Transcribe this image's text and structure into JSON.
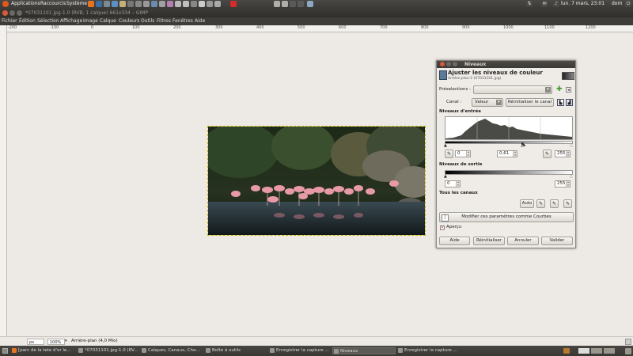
{
  "top_panel": {
    "menus": [
      "Applications",
      "Raccourcis",
      "Système"
    ],
    "clock": "lun. 7 mars, 23:01",
    "user": "dom"
  },
  "window": {
    "title": "*07031101.jpg-1.0 (RVB, 1 calque) 661x334 – GIMP"
  },
  "menu_bar": [
    "Fichier",
    "Édition",
    "Sélection",
    "Affichage",
    "Image",
    "Calque",
    "Couleurs",
    "Outils",
    "Filtres",
    "Fenêtres",
    "Aide"
  ],
  "ruler": {
    "labels": [
      "-200",
      "-100",
      "0",
      "100",
      "200",
      "300",
      "400",
      "500",
      "600",
      "700",
      "800",
      "900",
      "1000",
      "1100",
      "1200"
    ]
  },
  "status_bar": {
    "unit": "px",
    "zoom": "100%",
    "layer_info": "Arrière-plan (4,0 Mio)"
  },
  "taskbar": {
    "tasks": [
      "[parc de la tete d'or le...",
      "*07031101.jpg-1.0 (RV...",
      "Calques, Canaux, Che...",
      "Boîte à outils",
      "Enregistrer la capture ...",
      "Niveaux",
      "Enregistrer la capture ..."
    ]
  },
  "dialog": {
    "title": "Niveaux",
    "heading": "Ajuster les niveaux de couleur",
    "subheading": "Arrière-plan-2 (07031101.jpg)",
    "presets_label": "Préselections :",
    "presets_value": "",
    "channel_label": "Canal :",
    "channel_value": "Valeur",
    "reset_channel": "Réinitialiser le canal",
    "input_levels_label": "Niveaux d'entrée",
    "input_low": "0",
    "input_gamma": "0,61",
    "input_high": "255",
    "output_levels_label": "Niveaux de sortie",
    "output_low": "0",
    "output_high": "255",
    "all_channels_label": "Tous les canaux",
    "auto_button": "Auto",
    "curves_button": "Modifier ces paramètres comme Courbes",
    "preview_label": "Aperçu",
    "preview_checked": true,
    "buttons": {
      "help": "Aide",
      "reset": "Réinitialiser",
      "cancel": "Annuler",
      "ok": "Valider"
    }
  },
  "colors": {
    "accent": "#e05a1b",
    "panel": "#3c3b37",
    "canvas": "#edeae5"
  }
}
